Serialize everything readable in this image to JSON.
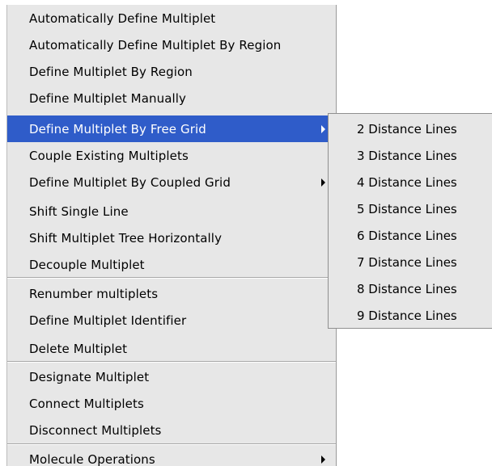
{
  "menu": {
    "items": [
      {
        "label": "Automatically Define Multiplet"
      },
      {
        "label": "Automatically Define Multiplet By Region"
      },
      {
        "label": "Define Multiplet By Region"
      },
      {
        "label": "Define Multiplet Manually"
      },
      {
        "label": "Define Multiplet By Free Grid",
        "selected": true,
        "has_submenu": true
      },
      {
        "label": "Couple Existing Multiplets"
      },
      {
        "label": "Define Multiplet By Coupled Grid",
        "has_submenu": true
      },
      {
        "label": "Shift Single Line"
      },
      {
        "label": "Shift Multiplet Tree Horizontally"
      },
      {
        "label": "Decouple Multiplet"
      },
      {
        "label": "Renumber multiplets"
      },
      {
        "label": "Define Multiplet Identifier"
      },
      {
        "label": "Delete Multiplet"
      },
      {
        "label": "Designate Multiplet"
      },
      {
        "label": "Connect Multiplets"
      },
      {
        "label": "Disconnect Multiplets"
      },
      {
        "label": "Molecule Operations",
        "has_submenu": true
      }
    ]
  },
  "submenu": {
    "items": [
      {
        "label": "2 Distance Lines"
      },
      {
        "label": "3 Distance Lines"
      },
      {
        "label": "4 Distance Lines"
      },
      {
        "label": "5 Distance Lines"
      },
      {
        "label": "6 Distance Lines"
      },
      {
        "label": "7 Distance Lines"
      },
      {
        "label": "8 Distance Lines"
      },
      {
        "label": "9 Distance Lines"
      }
    ]
  },
  "colors": {
    "menu_background": "#e7e7e7",
    "highlight": "#2f5cc9",
    "highlight_text": "#ffffff",
    "text": "#000000"
  },
  "icons": {
    "submenu_arrow": "triangle-right-icon"
  }
}
